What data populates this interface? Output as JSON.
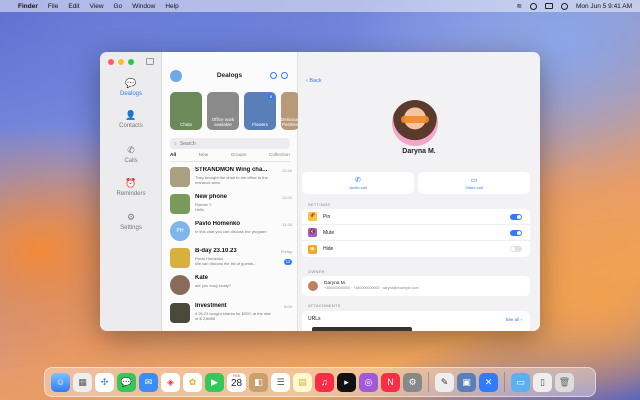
{
  "menubar": {
    "app": "Finder",
    "items": [
      "File",
      "Edit",
      "View",
      "Go",
      "Window",
      "Help"
    ],
    "clock": "Mon Jun 5  9:41 AM"
  },
  "sidebar": {
    "items": [
      {
        "label": "Dealogs",
        "icon": "chat-bubble-icon"
      },
      {
        "label": "Contacts",
        "icon": "person-icon"
      },
      {
        "label": "Calls",
        "icon": "phone-icon"
      },
      {
        "label": "Reminders",
        "icon": "alarm-icon"
      },
      {
        "label": "Settings",
        "icon": "gear-icon"
      }
    ]
  },
  "list": {
    "title": "Dealogs",
    "stories": [
      {
        "label": "Chats",
        "color": "#6b8a5a"
      },
      {
        "label": "Office work available",
        "color": "#8a8a8a"
      },
      {
        "label": "Flowers",
        "color": "#5a7fb8",
        "badge": "8"
      },
      {
        "label": "Delicious Pastries",
        "color": "#b89a7a"
      }
    ],
    "search_placeholder": "Search",
    "tabs": [
      "All",
      "New",
      "Groups",
      "Collection"
    ],
    "chats": [
      {
        "name": "STRANDMON Wing cha...",
        "sub": "They brought the chair to the office to the entrance area",
        "time": "12:34",
        "color": "#a8a080"
      },
      {
        "name": "New phone",
        "sub": "Roman T.\nHello",
        "time": "12:00",
        "color": "#7a9a5a"
      },
      {
        "name": "Pavlo Homenko",
        "sub": "In this chat you can discuss the program",
        "time": "11:30",
        "color": "#7eb6ec",
        "initials": "PH"
      },
      {
        "name": "B-day 23.10.23",
        "sub": "Pavlo Homenko\nWe can discuss the list of guests...",
        "time": "Friday",
        "color": "#d8b040",
        "count": "12"
      },
      {
        "name": "Kate",
        "sub": "are you busy today?",
        "time": "",
        "color": "#8a6a5a"
      },
      {
        "name": "Investment",
        "sub": "It 26.23 bought shares for $200, at the rate of $ 2,8865",
        "time": "8:00",
        "color": "#4a4a3a"
      }
    ]
  },
  "detail": {
    "back": "Back",
    "name": "Daryna M.",
    "actions": [
      {
        "label": "Audio call",
        "icon": "phone-icon"
      },
      {
        "label": "Video call",
        "icon": "video-icon"
      }
    ],
    "settings_header": "SETTINGS",
    "settings": [
      {
        "label": "Pin",
        "color": "#f5c542",
        "on": true
      },
      {
        "label": "Mute",
        "color": "#a05ad8",
        "on": true
      },
      {
        "label": "Hide",
        "color": "#f5a623",
        "on": false
      }
    ],
    "owner_header": "OWNER",
    "owner_name": "Daryna M.",
    "owner_contact": "+380000000000 · +380000000000 · daryna@example.com",
    "attachments_header": "ATTACHMENTS",
    "urls_label": "URLs",
    "see_all": "See all"
  },
  "dock": {
    "calendar_month": "FEB",
    "calendar_day": "28"
  }
}
